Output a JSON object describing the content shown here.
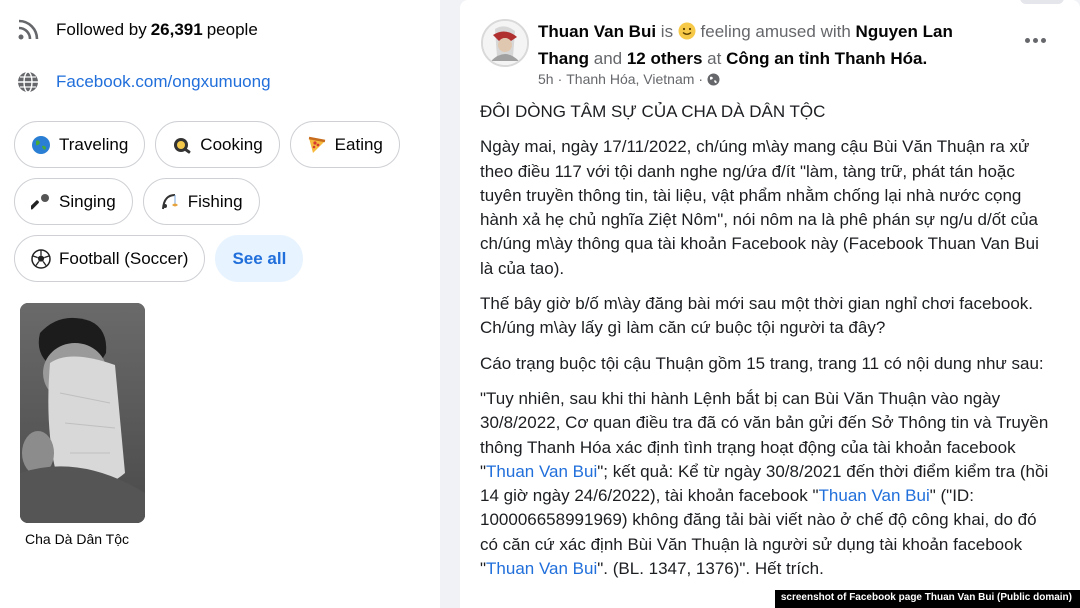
{
  "intro": {
    "followers_prefix": "Followed by",
    "followers_count": "26,391",
    "followers_suffix": "people",
    "website": "Facebook.com/ongxumuong",
    "hobbies": [
      {
        "label": "Traveling",
        "icon": "globe-icon"
      },
      {
        "label": "Cooking",
        "icon": "cooking-icon"
      },
      {
        "label": "Eating",
        "icon": "pizza-icon"
      },
      {
        "label": "Singing",
        "icon": "microphone-icon"
      },
      {
        "label": "Fishing",
        "icon": "fishing-icon"
      },
      {
        "label": "Football (Soccer)",
        "icon": "soccer-ball-icon"
      }
    ],
    "see_all": "See all",
    "photo_caption": "Cha Dà Dân Tộc"
  },
  "post": {
    "author": "Thuan Van Bui",
    "is_text": "is",
    "feeling_text": "feeling amused with",
    "tagged": "Nguyen Lan Thang",
    "and_text": "and",
    "others": "12 others",
    "at_text": "at",
    "place": "Công an tỉnh Thanh Hóa.",
    "time": "5h",
    "location": "Thanh Hóa, Vietnam",
    "title": "ĐÔI DÒNG TÂM SỰ CỦA CHA DÀ DÂN TỘC",
    "p1": "Ngày mai, ngày 17/11/2022, ch/úng m\\ày mang  cậu Bùi Văn Thuận ra xử  theo điều 117 với tội danh nghe ng/ứa đ/ít \"làm, tàng trữ, phát tán hoặc tuyên truyền thông tin, tài liệu, vật phẩm nhằm chống lại nhà nước cọng hành xả hẹ chủ nghĩa Ziệt Nôm\", nói nôm na là phê phán sự ng/u d/ốt của ch/úng m\\ày thông qua tài khoản Facebook này (Facebook Thuan Van Bui là của tao).",
    "p2": "Thế bây giờ b/ố m\\ày  đăng bài mới sau một thời gian nghỉ chơi facebook. Ch/úng m\\ày lấy gì làm căn cứ buộc tội người ta đây?",
    "p3": " Cáo trạng buộc tội cậu Thuận gồm 15 trang, trang 11 có nội dung như sau:",
    "p4_a": "\"Tuy nhiên, sau khi thi hành Lệnh bắt bị can Bùi Văn Thuận vào ngày 30/8/2022, Cơ quan điều tra đã có văn bản gửi đến Sở Thông tin và Truyền thông Thanh Hóa xác định tình trạng hoạt động của tài khoản facebook \"",
    "link_name": "Thuan Van Bui",
    "p4_b": "\"; kết quả: Kể từ ngày 30/8/2021 đến thời điểm kiểm tra (hồi 14 giờ ngày 24/6/2022), tài khoản facebook \"",
    "p4_c": "\" (\"ID: 100006658991969) không đăng tải bài viết nào ở chế độ công khai, do đó có căn cứ xác định Bùi Văn Thuận là người sử dụng tài khoản facebook \"",
    "p4_d": "\". (BL. 1347, 1376)\". Hết trích."
  },
  "credit": "screenshot of Facebook page Thuan Van Bui (Public domain)",
  "colors": {
    "link": "#216fdb",
    "chip_border": "#ced0d4",
    "see_all_bg": "#e7f3ff",
    "muted": "#65676b"
  }
}
